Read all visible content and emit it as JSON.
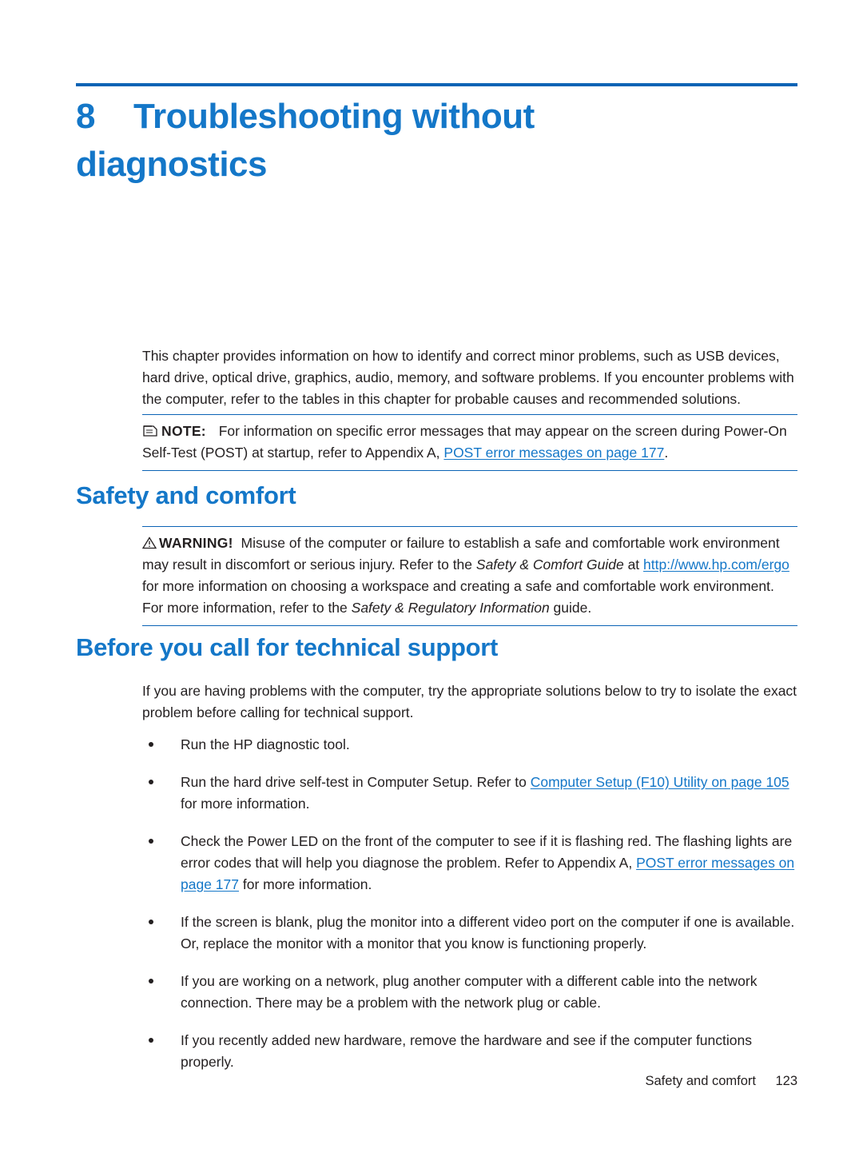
{
  "chapter": {
    "number": "8",
    "title": "Troubleshooting without diagnostics"
  },
  "intro": {
    "paragraph": "This chapter provides information on how to identify and correct minor problems, such as USB devices, hard drive, optical drive, graphics, audio, memory, and software problems. If you encounter problems with the computer, refer to the tables in this chapter for probable causes and recommended solutions."
  },
  "note": {
    "icon": "note-icon",
    "label": "NOTE:",
    "text_before_link": "For information on specific error messages that may appear on the screen during Power-On Self-Test (POST) at startup, refer to Appendix A, ",
    "link": "POST error messages on page 177",
    "text_after_link": "."
  },
  "sections": {
    "safety_heading": "Safety and comfort",
    "before_heading": "Before you call for technical support"
  },
  "warning": {
    "icon": "warning-triangle-icon",
    "label": "WARNING!",
    "text_1": "Misuse of the computer or failure to establish a safe and comfortable work environment may result in discomfort or serious injury. Refer to the ",
    "italic_1": "Safety & Comfort Guide",
    "text_2": " at ",
    "link": "http://www.hp.com/ergo",
    "text_3": " for more information on choosing a workspace and creating a safe and comfortable work environment. For more information, refer to the ",
    "italic_2": "Safety & Regulatory Information",
    "text_4": " guide."
  },
  "before_support": {
    "paragraph": "If you are having problems with the computer, try the appropriate solutions below to try to isolate the exact problem before calling for technical support.",
    "bullets": [
      {
        "text_before_link": "Run the HP diagnostic tool.",
        "link": "",
        "text_after_link": ""
      },
      {
        "text_before_link": "Run the hard drive self-test in Computer Setup. Refer to ",
        "link": "Computer Setup (F10) Utility on page 105",
        "text_after_link": " for more information."
      },
      {
        "text_before_link": "Check the Power LED on the front of the computer to see if it is flashing red. The flashing lights are error codes that will help you diagnose the problem. Refer to Appendix A, ",
        "link": "POST error messages on page 177",
        "text_after_link": " for more information."
      },
      {
        "text_before_link": "If the screen is blank, plug the monitor into a different video port on the computer if one is available. Or, replace the monitor with a monitor that you know is functioning properly.",
        "link": "",
        "text_after_link": ""
      },
      {
        "text_before_link": "If you are working on a network, plug another computer with a different cable into the network connection. There may be a problem with the network plug or cable.",
        "link": "",
        "text_after_link": ""
      },
      {
        "text_before_link": "If you recently added new hardware, remove the hardware and see if the computer functions properly.",
        "link": "",
        "text_after_link": ""
      }
    ]
  },
  "footer": {
    "section_label": "Safety and comfort",
    "page_number": "123"
  },
  "colors": {
    "accent_blue": "#1477c8",
    "rule_blue": "#0b63b5",
    "body_text": "#231f20"
  }
}
